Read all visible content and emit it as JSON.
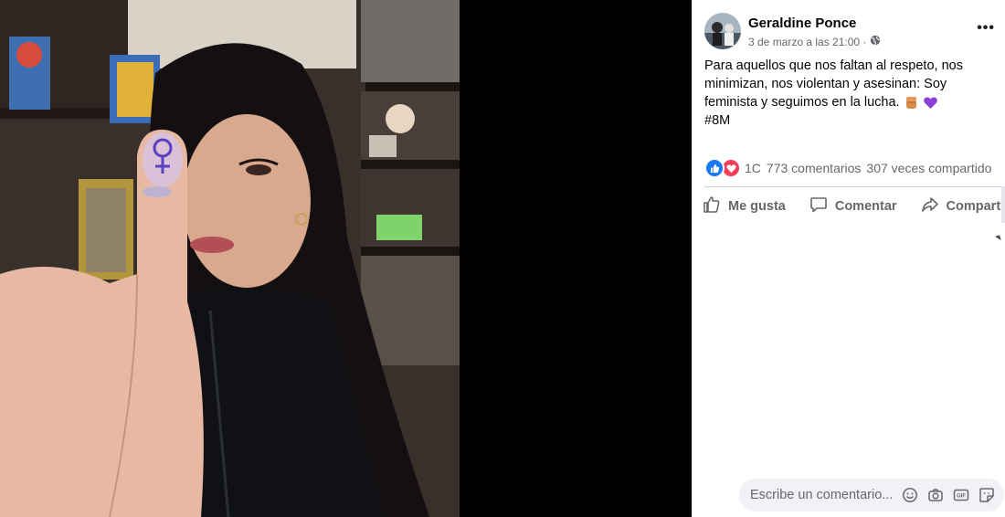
{
  "post": {
    "author": "Geraldine Ponce",
    "timestamp": "3 de marzo a las 21:00 ·",
    "text_lines": [
      "Para aquellos que nos faltan al respeto, nos minimizan, nos violentan y asesinan: Soy feminista y seguimos en la lucha."
    ],
    "hashtag": "#8M",
    "emoji_icons": [
      "raised-fist-emoji",
      "purple-heart-emoji"
    ],
    "audience_icon": "globe-icon",
    "more_label": "•••"
  },
  "stats": {
    "reaction_icons": [
      "like-reaction-icon",
      "love-reaction-icon"
    ],
    "reactions_count": "1C",
    "comments": "773 comentarios",
    "shares": "307 veces compartido"
  },
  "actions": {
    "like": "Me gusta",
    "comment": "Comentar",
    "share": "Compartir"
  },
  "comment_box": {
    "placeholder": "Escribe un comentario...",
    "icons": [
      "emoji-icon",
      "camera-icon",
      "gif-icon",
      "sticker-icon"
    ]
  },
  "colors": {
    "brand_blue": "#1877f2",
    "love_red": "#f33e58",
    "secondary_text": "#65676b"
  }
}
